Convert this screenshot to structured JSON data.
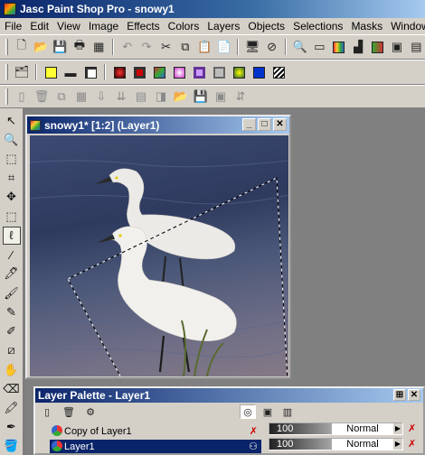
{
  "app": {
    "title": "Jasc Paint Shop Pro - snowy1"
  },
  "menu": [
    "File",
    "Edit",
    "View",
    "Image",
    "Effects",
    "Colors",
    "Layers",
    "Objects",
    "Selections",
    "Masks",
    "Window"
  ],
  "document": {
    "title": "snowy1* [1:2] (Layer1)"
  },
  "layer_palette": {
    "title": "Layer Palette - Layer1",
    "layers": [
      {
        "name": "Copy of Layer1",
        "opacity": "100",
        "blend": "Normal"
      },
      {
        "name": "Layer1",
        "opacity": "100",
        "blend": "Normal",
        "selected": true
      }
    ]
  },
  "colors": {
    "title_active": "#0a246a",
    "face": "#d4d0c8",
    "workspace": "#808080"
  }
}
